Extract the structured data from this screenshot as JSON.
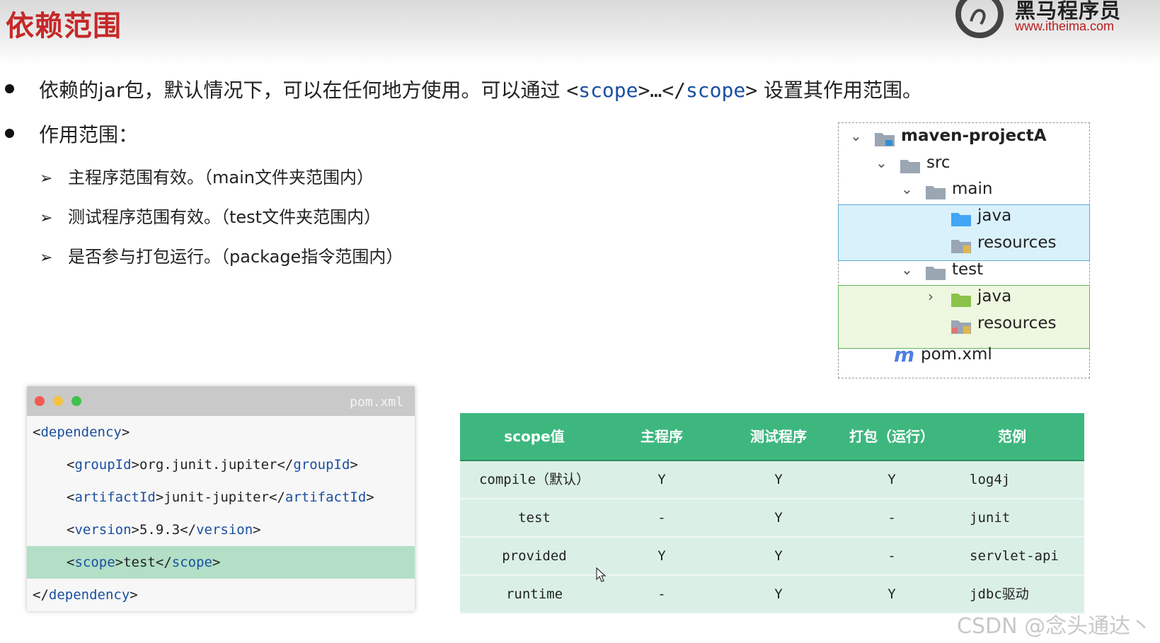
{
  "header": {
    "title": "依赖范围",
    "brand_name": "黑马程序员",
    "brand_url": "www.itheima.com"
  },
  "bullets": {
    "b1_prefix": "依赖的jar包，默认情况下，可以在任何地方使用。可以通过 ",
    "b1_lt1": "<",
    "b1_tag1": "scope",
    "b1_mid": ">…</",
    "b1_tag2": "scope",
    "b1_gt": ">",
    "b1_suffix": " 设置其作用范围。",
    "b2": "作用范围："
  },
  "sub_items": [
    {
      "arrow": "➢",
      "text": "主程序范围有效。（main文件夹范围内）"
    },
    {
      "arrow": "➢",
      "text": "测试程序范围有效。（test文件夹范围内）"
    },
    {
      "arrow": "➢",
      "text": "是否参与打包运行。（package指令范围内）"
    }
  ],
  "tree": {
    "project": "maven-projectA",
    "src": "src",
    "main": "main",
    "main_java": "java",
    "main_resources": "resources",
    "test": "test",
    "test_java": "java",
    "test_resources": "resources",
    "pom_icon": "m",
    "pom": "pom.xml"
  },
  "code": {
    "filename": "pom.xml",
    "lines": [
      {
        "open": "<",
        "tag": "dependency",
        "close": ">",
        "value": "",
        "open2": "",
        "tag2": "",
        "close2": ""
      },
      {
        "open": "<",
        "tag": "groupId",
        "close": ">",
        "value": "org.junit.jupiter",
        "open2": "</",
        "tag2": "groupId",
        "close2": ">"
      },
      {
        "open": "<",
        "tag": "artifactId",
        "close": ">",
        "value": "junit-jupiter",
        "open2": "</",
        "tag2": "artifactId",
        "close2": ">"
      },
      {
        "open": "<",
        "tag": "version",
        "close": ">",
        "value": "5.9.3",
        "open2": "</",
        "tag2": "version",
        "close2": ">"
      },
      {
        "open": "<",
        "tag": "scope",
        "close": ">",
        "value": "test",
        "open2": "</",
        "tag2": "scope",
        "close2": ">"
      },
      {
        "open": "</",
        "tag": "dependency",
        "close": ">",
        "value": "",
        "open2": "",
        "tag2": "",
        "close2": ""
      }
    ]
  },
  "table": {
    "headers": [
      "scope值",
      "主程序",
      "测试程序",
      "打包（运行）",
      "范例"
    ],
    "rows": [
      [
        "compile（默认）",
        "Y",
        "Y",
        "Y",
        "log4j"
      ],
      [
        "test",
        "-",
        "Y",
        "-",
        "junit"
      ],
      [
        "provided",
        "Y",
        "Y",
        "-",
        "servlet-api"
      ],
      [
        "runtime",
        "-",
        "Y",
        "Y",
        "jdbc驱动"
      ]
    ]
  },
  "watermark": "CSDN @念头通达丶",
  "colors": {
    "title_red": "#c62828",
    "table_header": "#3eb77f",
    "table_row": "#daf0e6",
    "code_highlight": "#b2dfc6",
    "tag_blue": "#1a4fa0"
  }
}
